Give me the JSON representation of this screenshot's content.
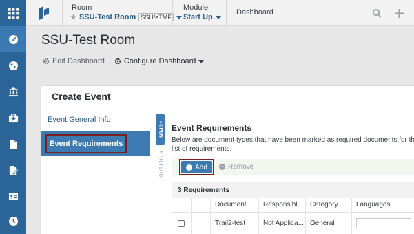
{
  "rail": {
    "items": [
      {
        "icon": "grid-icon"
      },
      {
        "icon": "dashboard-gauge-icon"
      },
      {
        "icon": "globe-icon"
      },
      {
        "icon": "bank-icon"
      },
      {
        "icon": "medical-kit-icon"
      },
      {
        "icon": "document-icon"
      },
      {
        "icon": "document-sign-icon"
      },
      {
        "icon": "id-card-icon"
      },
      {
        "icon": "clock-icon"
      }
    ]
  },
  "topbar": {
    "room_label": "Room",
    "room_value": "SSU-Test Room",
    "room_tag": "SSU/eTMF",
    "module_label": "Module",
    "module_value": "Start Up",
    "dashboard_label": "Dashboard",
    "icons": [
      "search-icon",
      "plus-icon"
    ]
  },
  "page": {
    "title": "SSU-Test Room",
    "edit_dashboard": "Edit Dashboard",
    "configure_dashboard": "Configure Dashboard"
  },
  "modal": {
    "title": "Create Event",
    "steps": [
      {
        "label": "Event General Info"
      },
      {
        "label": "Event Requirements"
      }
    ],
    "filters_open": "OPEN",
    "filters_label": "FILTERS",
    "requirements": {
      "title": "Event Requirements",
      "description_line1": "Below are document types that have been marked as required documents for this eve",
      "description_line2": "list of requirements.",
      "add_label": "Add",
      "remove_label": "Remove",
      "count_label": "3 Requirements",
      "columns": [
        "",
        "",
        "Document ...",
        "Responsibl...",
        "Category",
        "Languages"
      ],
      "rows": [
        {
          "document": "Trail2-test",
          "responsible": "Not Applica...",
          "category": "General",
          "languages": ""
        }
      ]
    }
  },
  "colors": {
    "rail": "#2b6597",
    "accent": "#3d7ab2",
    "highlight_outline": "#7a1f1f",
    "link": "#2b5f8d"
  }
}
